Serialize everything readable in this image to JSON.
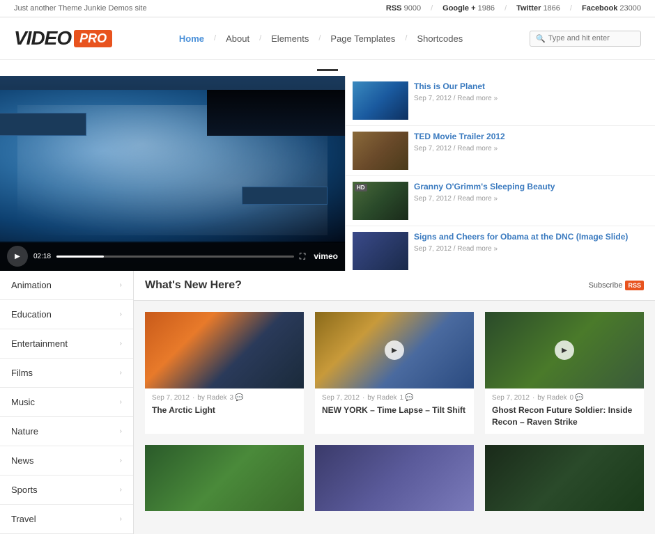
{
  "topbar": {
    "tagline": "Just another Theme Junkie Demos site",
    "social": [
      {
        "name": "RSS",
        "count": "9000"
      },
      {
        "name": "Google +",
        "count": "1986"
      },
      {
        "name": "Twitter",
        "count": "1866"
      },
      {
        "name": "Facebook",
        "count": "23000"
      }
    ]
  },
  "header": {
    "logo_text": "VIDEO",
    "logo_pro": "PRO"
  },
  "nav": {
    "items": [
      {
        "label": "Home",
        "active": true
      },
      {
        "label": "About",
        "active": false
      },
      {
        "label": "Elements",
        "active": false
      },
      {
        "label": "Page Templates",
        "active": false
      },
      {
        "label": "Shortcodes",
        "active": false
      }
    ],
    "search_placeholder": "Type and hit enter"
  },
  "hero": {
    "video_time": "02:18",
    "sidebar_items": [
      {
        "title": "This is Our Planet",
        "meta": "Sep 7, 2012 / Read more »",
        "thumb_class": "thumb-earth"
      },
      {
        "title": "TED Movie Trailer 2012",
        "meta": "Sep 7, 2012 / Read more »",
        "thumb_class": "thumb-crowd"
      },
      {
        "title": "Granny O'Grimm's Sleeping Beauty",
        "meta": "Sep 7, 2012 / Read more »",
        "thumb_class": "thumb-cartoon",
        "has_hd": true
      },
      {
        "title": "Signs and Cheers for Obama at the DNC (Image Slide)",
        "meta": "Sep 7, 2012 / Read more »",
        "thumb_class": "thumb-dnc"
      }
    ]
  },
  "sidebar_nav": {
    "items": [
      {
        "label": "Animation"
      },
      {
        "label": "Education"
      },
      {
        "label": "Entertainment"
      },
      {
        "label": "Films"
      },
      {
        "label": "Music"
      },
      {
        "label": "Nature"
      },
      {
        "label": "News"
      },
      {
        "label": "Sports"
      },
      {
        "label": "Travel"
      }
    ]
  },
  "content": {
    "section_title": "What's New Here?",
    "subscribe_label": "Subscribe",
    "articles": [
      {
        "meta_date": "Sep 7, 2012",
        "meta_author": "by Radek",
        "comments": "3",
        "title": "The Arctic Light",
        "thumb_class": "thumb-arctic",
        "has_play": false
      },
      {
        "meta_date": "Sep 7, 2012",
        "meta_author": "by Radek",
        "comments": "1",
        "title": "NEW YORK – Time Lapse – Tilt Shift",
        "thumb_class": "thumb-newyork",
        "has_play": true
      },
      {
        "meta_date": "Sep 7, 2012",
        "meta_author": "by Radek",
        "comments": "0",
        "title": "Ghost Recon Future Soldier: Inside Recon – Raven Strike",
        "thumb_class": "thumb-ghost",
        "has_play": true
      }
    ],
    "articles2": [
      {
        "thumb_class": "thumb-forest"
      },
      {
        "thumb_class": "thumb-city2"
      },
      {
        "thumb_class": "thumb-dark"
      }
    ]
  }
}
